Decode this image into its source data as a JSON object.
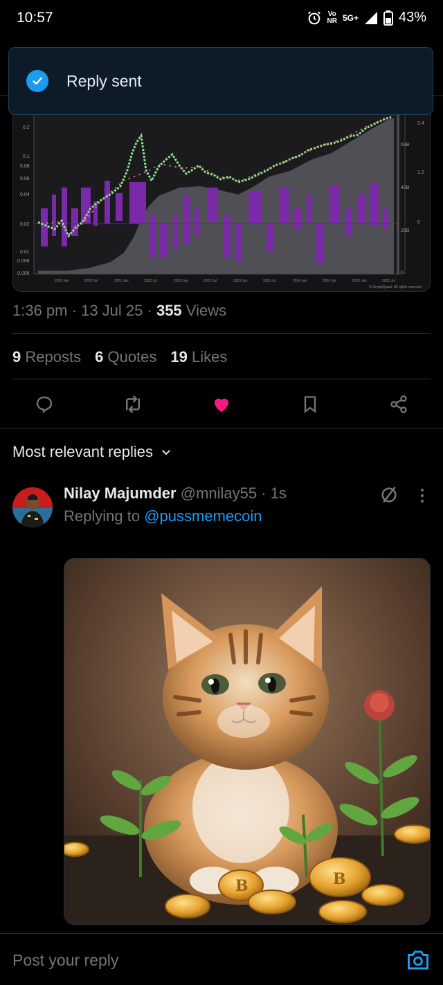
{
  "status": {
    "time": "10:57",
    "net_top": "Vo",
    "net_bottom": "NR",
    "net_type": "5G+",
    "battery": "43%"
  },
  "toast": {
    "text": "Reply sent"
  },
  "chart": {
    "y_left_ticks": [
      "0.2",
      "0.1",
      "0.08",
      "0.06",
      "0.04",
      "0.02",
      "0.01",
      "0.008",
      "0.006"
    ],
    "y_right_ticks": [
      "2.4",
      "60B",
      "1.2",
      "40B",
      "0",
      "20B",
      "0"
    ],
    "x_ticks": [
      "2020 Jan",
      "2020 Jul",
      "2021 Jan",
      "2021 Jul",
      "2022 Jan",
      "2022 Jul",
      "2023 Jan",
      "2023 Jul",
      "2024 Jan",
      "2024 Jul",
      "2025 Jan",
      "2025 Jul"
    ],
    "copyright": "© CryptoQuant. All rights reserved"
  },
  "post_meta": {
    "time": "1:36 pm",
    "date": "13 Jul 25",
    "views_count": "355",
    "views_label": "Views"
  },
  "stats": {
    "reposts_count": "9",
    "reposts_label": "Reposts",
    "quotes_count": "6",
    "quotes_label": "Quotes",
    "likes_count": "19",
    "likes_label": "Likes"
  },
  "actions": {
    "icons": [
      "reply-icon",
      "repost-icon",
      "like-icon",
      "bookmark-icon",
      "share-icon"
    ],
    "like_color": "#f91880"
  },
  "replies": {
    "sort_label": "Most relevant replies"
  },
  "reply": {
    "name": "Nilay Majumder",
    "handle": "@mnilay55",
    "time": "1s",
    "replying_label": "Replying to",
    "mention": "@pussmemecoin"
  },
  "composer": {
    "placeholder": "Post your reply"
  },
  "colors": {
    "accent": "#1d9bf0",
    "background": "#000000",
    "muted": "#71767b",
    "toast_bg": "#0d1b29"
  }
}
